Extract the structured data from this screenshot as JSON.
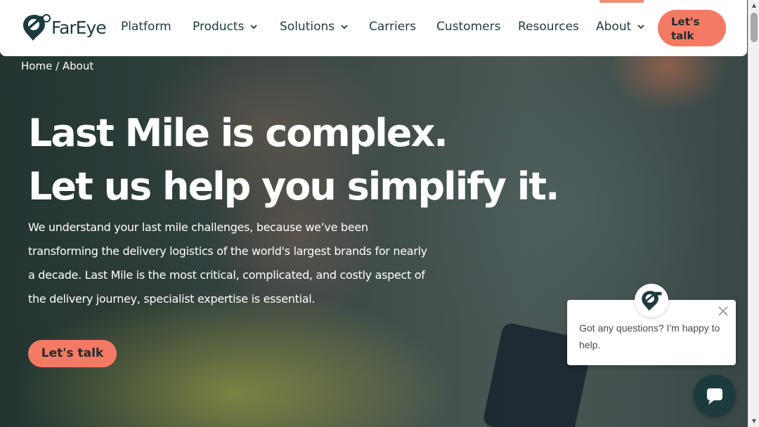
{
  "brand": {
    "name": "FarEye"
  },
  "nav": {
    "items": [
      {
        "label": "Platform",
        "has_dropdown": false
      },
      {
        "label": "Products",
        "has_dropdown": true
      },
      {
        "label": "Solutions",
        "has_dropdown": true
      },
      {
        "label": "Carriers",
        "has_dropdown": false
      },
      {
        "label": "Customers",
        "has_dropdown": false
      },
      {
        "label": "Resources",
        "has_dropdown": false
      },
      {
        "label": "About",
        "has_dropdown": true
      }
    ],
    "cta_label_line1": "Let's",
    "cta_label_line2": "talk"
  },
  "breadcrumb": {
    "home": "Home",
    "separator": " / ",
    "current": "About"
  },
  "hero": {
    "title_line1": "Last Mile is complex.",
    "title_line2": "Let us help you simplify it.",
    "description": "We understand your last mile challenges, because we’ve been transforming the delivery logistics of the world's largest brands for nearly a decade. Last Mile is the most critical, complicated, and costly aspect of the delivery journey, specialist expertise is essential.",
    "cta_label": "Let's talk"
  },
  "chat": {
    "message": "Got any questions? I'm happy to help."
  },
  "colors": {
    "brand_dark": "#1d3b3f",
    "accent": "#f47a63"
  }
}
